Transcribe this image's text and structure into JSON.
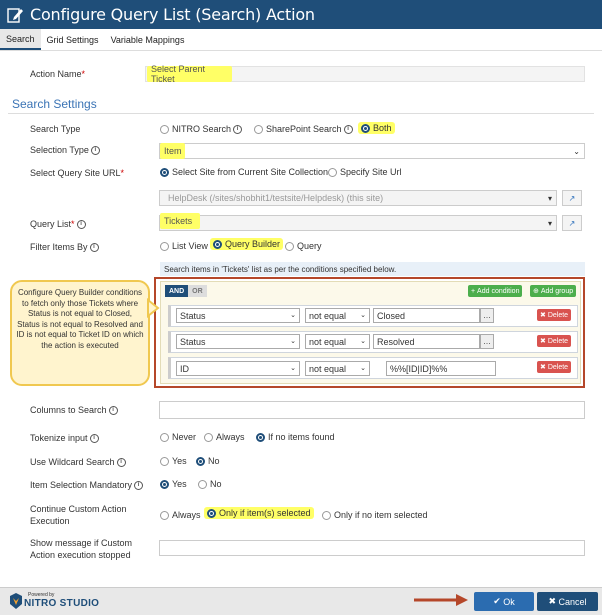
{
  "window": {
    "title": "Configure Query List (Search) Action"
  },
  "tabs": [
    "Search",
    "Grid Settings",
    "Variable Mappings"
  ],
  "action_name": {
    "label": "Action Name",
    "value": "Select Parent Ticket"
  },
  "section_title": "Search Settings",
  "search_type": {
    "label": "Search Type",
    "options": [
      "NITRO Search",
      "SharePoint Search",
      "Both"
    ],
    "selected": "Both"
  },
  "selection_type": {
    "label": "Selection Type",
    "value": "Item"
  },
  "query_site": {
    "label": "Select Query Site URL",
    "options": [
      "Select Site from Current Site Collection",
      "Specify Site Url"
    ],
    "selected": "Select Site from Current Site Collection",
    "value": "HelpDesk (/sites/shobhit1/testsite/Helpdesk) (this site)"
  },
  "query_list": {
    "label": "Query List",
    "value": "Tickets"
  },
  "filter_items": {
    "label": "Filter Items By",
    "options": [
      "List View",
      "Query Builder",
      "Query"
    ],
    "selected": "Query Builder"
  },
  "query_builder": {
    "header": "Search items in 'Tickets' list as per the conditions specified below.",
    "and_label": "AND",
    "or_label": "OR",
    "add_condition": "Add condition",
    "add_group": "Add group",
    "delete_label": "Delete",
    "rules": [
      {
        "field": "Status",
        "operator": "not equal",
        "value": "Closed"
      },
      {
        "field": "Status",
        "operator": "not equal",
        "value": "Resolved"
      },
      {
        "field": "ID",
        "operator": "not equal",
        "value": "%%[ID|ID]%%"
      }
    ]
  },
  "callout": "Configure Query Builder conditions to fetch only those Tickets where Status is not equal to Closed, Status is not equal to Resolved and ID is not equal to Ticket ID on which the action is executed",
  "columns_to_search": {
    "label": "Columns to Search",
    "value": ""
  },
  "tokenize": {
    "label": "Tokenize input",
    "options": [
      "Never",
      "Always",
      "If no items found"
    ],
    "selected": "If no items found"
  },
  "wildcard": {
    "label": "Use Wildcard Search",
    "options": [
      "Yes",
      "No"
    ],
    "selected": "No"
  },
  "mandatory": {
    "label": "Item Selection Mandatory",
    "options": [
      "Yes",
      "No"
    ],
    "selected": "Yes"
  },
  "continue_exec": {
    "label_line1": "Continue Custom Action",
    "label_line2": "Execution",
    "options": [
      "Always",
      "Only if item(s) selected",
      "Only if no item selected"
    ],
    "selected": "Only if item(s) selected"
  },
  "show_message": {
    "label_line1": "Show message if Custom",
    "label_line2": "Action execution stopped",
    "value": ""
  },
  "footer": {
    "logo_top": "Powered by",
    "logo_main": "NITRO STUDIO",
    "ok": "Ok",
    "cancel": "Cancel"
  },
  "colors": {
    "header": "#1f4e79",
    "highlight": "#ffff66",
    "accent_red": "#b5472a",
    "ok": "#2b6cb0"
  }
}
